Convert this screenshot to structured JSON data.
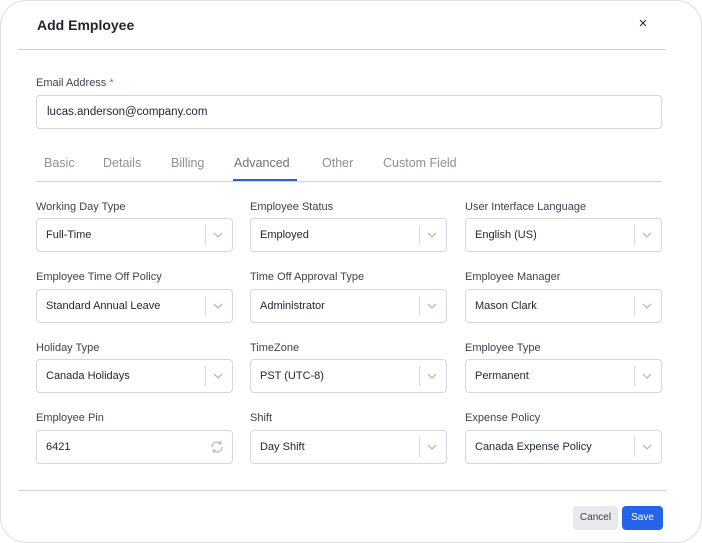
{
  "modal": {
    "title": "Add Employee",
    "close_glyph": "×"
  },
  "email": {
    "label": "Email Address",
    "required_mark": "*",
    "value": "lucas.anderson@company.com"
  },
  "tabs": [
    {
      "label": "Basic",
      "active": false
    },
    {
      "label": "Details",
      "active": false
    },
    {
      "label": "Billing",
      "active": false
    },
    {
      "label": "Advanced",
      "active": true
    },
    {
      "label": "Other",
      "active": false
    },
    {
      "label": "Custom Field",
      "active": false
    }
  ],
  "fields": {
    "working_day_type": {
      "label": "Working Day Type",
      "value": "Full-Time"
    },
    "employee_status": {
      "label": "Employee Status",
      "value": "Employed"
    },
    "ui_language": {
      "label": "User Interface Language",
      "value": "English (US)"
    },
    "time_off_policy": {
      "label": "Employee Time Off Policy",
      "value": "Standard Annual Leave"
    },
    "time_off_approval": {
      "label": "Time Off Approval Type",
      "value": "Administrator"
    },
    "employee_manager": {
      "label": "Employee Manager",
      "value": "Mason Clark"
    },
    "holiday_type": {
      "label": "Holiday Type",
      "value": "Canada Holidays"
    },
    "timezone": {
      "label": "TimeZone",
      "value": "PST (UTC-8)"
    },
    "employee_type": {
      "label": "Employee Type",
      "value": "Permanent"
    },
    "employee_pin": {
      "label": "Employee Pin",
      "value": "6421"
    },
    "shift": {
      "label": "Shift",
      "value": "Day Shift"
    },
    "expense_policy": {
      "label": "Expense Policy",
      "value": "Canada Expense Policy"
    }
  },
  "footer": {
    "cancel_label": "Cancel",
    "save_label": "Save"
  },
  "colors": {
    "accent": "#2563eb",
    "tab_underline": "#2f5fd1",
    "required": "#e25555"
  }
}
